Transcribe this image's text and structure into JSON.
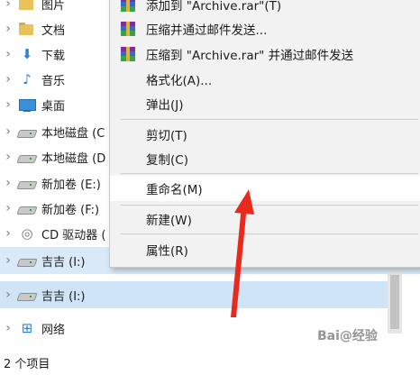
{
  "tree": [
    {
      "label": "图片",
      "icon": "pictures-folder-icon"
    },
    {
      "label": "文档",
      "icon": "documents-folder-icon"
    },
    {
      "label": "下载",
      "icon": "download-arrow-icon"
    },
    {
      "label": "音乐",
      "icon": "music-note-icon"
    },
    {
      "label": "桌面",
      "icon": "desktop-icon"
    },
    {
      "label": "本地磁盘 (C",
      "icon": "local-disk-icon"
    },
    {
      "label": "本地磁盘 (D",
      "icon": "local-disk-icon"
    },
    {
      "label": "新加卷 (E:)",
      "icon": "drive-icon"
    },
    {
      "label": "新加卷 (F:)",
      "icon": "drive-icon"
    },
    {
      "label": "CD 驱动器 (",
      "icon": "cd-drive-icon"
    },
    {
      "label": "吉吉 (I:)",
      "icon": "usb-drive-icon"
    }
  ],
  "tree_bottom": [
    {
      "label": "吉吉 (I:)",
      "icon": "usb-drive-icon"
    },
    {
      "label": "网络",
      "icon": "network-icon"
    },
    {
      "label": "2 个项目",
      "icon": ""
    }
  ],
  "menu": {
    "items": [
      {
        "label": "添加到 \"Archive.rar\"(T)",
        "icon": "winrar-icon"
      },
      {
        "label": "压缩并通过邮件发送...",
        "icon": "winrar-icon"
      },
      {
        "label": "压缩到 \"Archive.rar\" 并通过邮件发送",
        "icon": "winrar-icon"
      },
      {
        "label": "格式化(A)..."
      },
      {
        "label": "弹出(J)"
      },
      {
        "label": "剪切(T)"
      },
      {
        "label": "复制(C)"
      },
      {
        "label": "重命名(M)"
      },
      {
        "label": "新建(W)"
      },
      {
        "label": "属性(R)"
      }
    ]
  },
  "watermark": "Bai@经验"
}
